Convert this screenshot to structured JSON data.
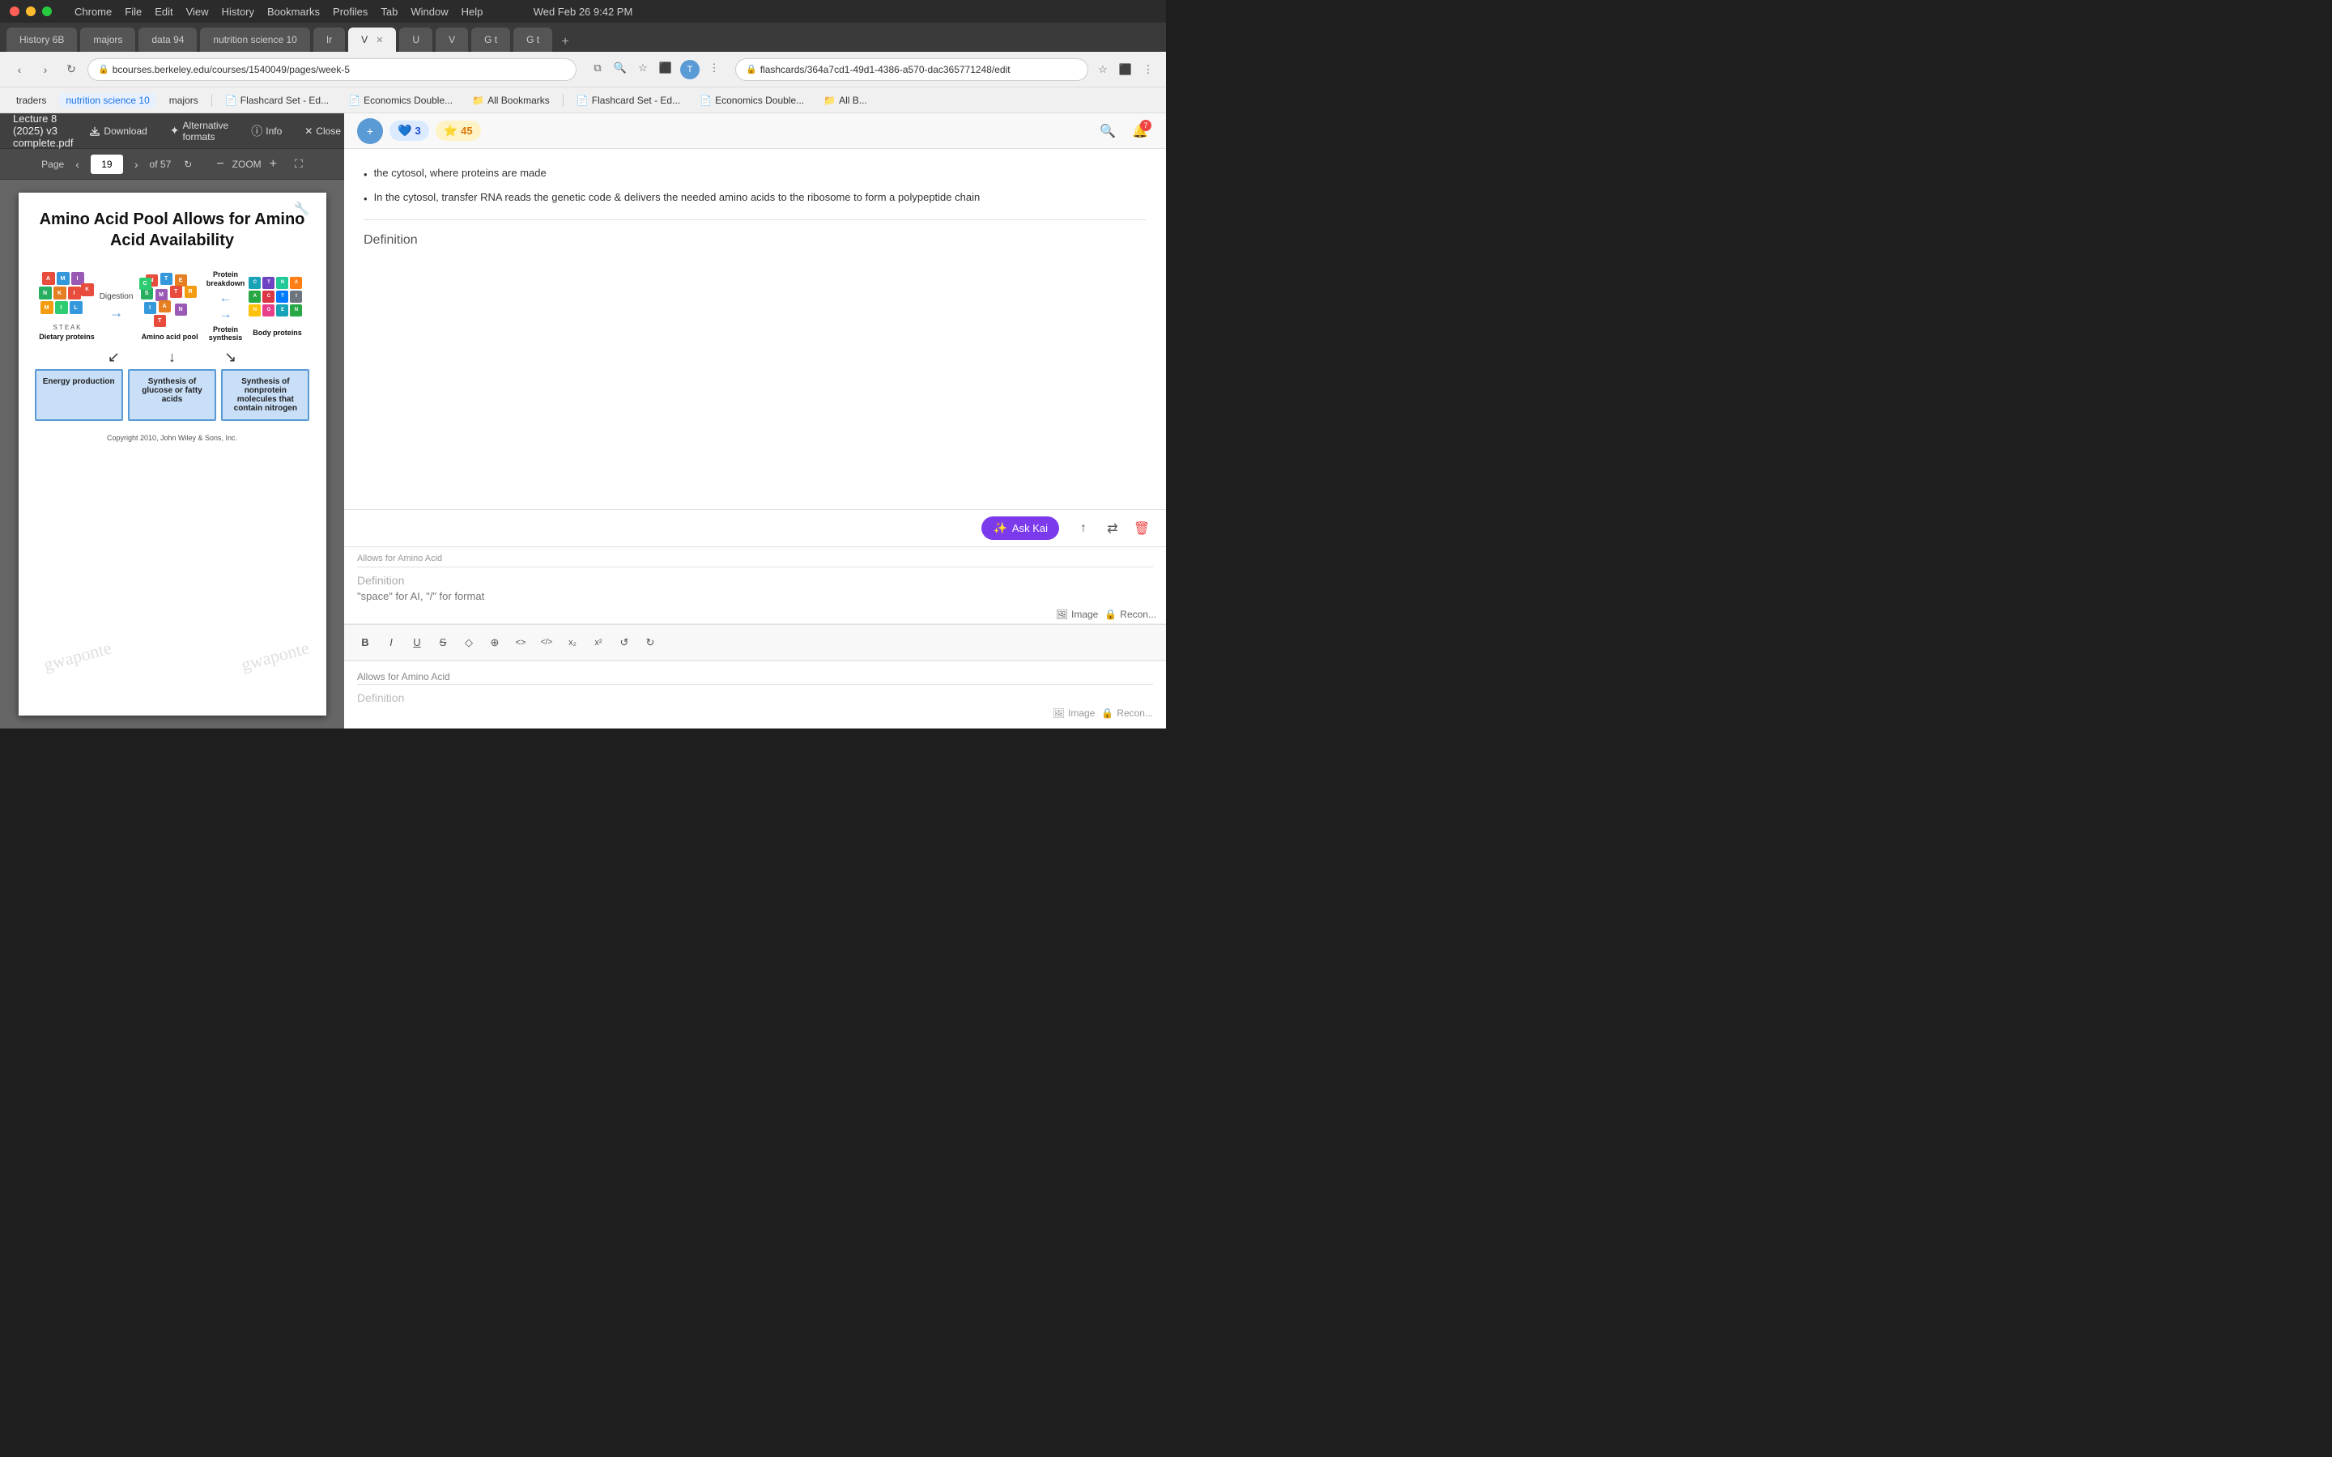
{
  "titlebar": {
    "menus": [
      "Chrome",
      "File",
      "Edit",
      "View",
      "History",
      "Bookmarks",
      "Profiles",
      "Tab",
      "Window",
      "Help"
    ],
    "time": "Wed Feb 26  9:42 PM"
  },
  "tabs": [
    {
      "label": "History 6B",
      "active": false
    },
    {
      "label": "majors",
      "active": false
    },
    {
      "label": "data 94",
      "active": false
    },
    {
      "label": "nutrition science 10",
      "active": false
    },
    {
      "label": "Ir",
      "active": false
    },
    {
      "label": "V",
      "active": true
    },
    {
      "label": "U",
      "active": false
    },
    {
      "label": "V",
      "active": false
    },
    {
      "label": "G t",
      "active": false
    },
    {
      "label": "G t",
      "active": false
    }
  ],
  "urlbar": {
    "url": "bcourses.berkeley.edu/courses/1540049/pages/week-5",
    "right_url": "flashcards/364a7cd1-49d1-4386-a570-dac365771248/edit"
  },
  "bookmarks": [
    {
      "label": "traders"
    },
    {
      "label": "nutrition science 10",
      "highlighted": true
    },
    {
      "label": "majors"
    },
    {
      "label": "Flashcard Set - Ed..."
    },
    {
      "label": "Economics Double..."
    },
    {
      "label": "All Bookmarks"
    },
    {
      "label": "Flashcard Set - Ed..."
    },
    {
      "label": "Economics Double..."
    },
    {
      "label": "All B..."
    }
  ],
  "pdf": {
    "title": "Lecture 8 (2025) v3 complete.pdf",
    "page_current": "19",
    "page_total": "of 57",
    "zoom": "ZOOM",
    "toolbar_buttons": {
      "download": "Download",
      "alternative_formats": "Alternative formats",
      "info": "Info",
      "close": "Close"
    },
    "diagram": {
      "title": "Amino Acid Pool Allows for Amino Acid Availability",
      "dietary_label": "Dietary proteins",
      "digestion_label": "Digestion",
      "amino_pool_label": "Amino acid pool",
      "protein_breakdown_label": "Protein breakdown",
      "protein_synthesis_label": "Protein synthesis",
      "body_proteins_label": "Body proteins",
      "bottom_boxes": [
        "Energy production",
        "Synthesis of glucose or fatty acids",
        "Synthesis of nonprotein molecules that contain nitrogen"
      ],
      "copyright": "Copyright 2010, John Wiley & Sons, Inc."
    }
  },
  "flashcard": {
    "badge_blue_count": "3",
    "badge_orange_count": "45",
    "content_bullets": [
      "the cytosol, where proteins are made",
      "In the cytosol, transfer RNA reads the genetic code & delivers the needed amino acids to the ribosome to form a polypeptide chain"
    ],
    "definition_label": "Definition",
    "card_front_text": "Allows for Amino Acid",
    "format_hint": "\"space\" for AI, \"/\" for format",
    "definition_placeholder": "Definition",
    "ask_kai_label": "Ask Kai",
    "format_buttons": [
      "B",
      "I",
      "U",
      "S",
      "◇",
      "⊕",
      "<>",
      "</>",
      "x₂",
      "x²",
      "↺",
      "↻"
    ],
    "action_buttons": [
      "↑",
      "⇄",
      "🗑"
    ]
  }
}
